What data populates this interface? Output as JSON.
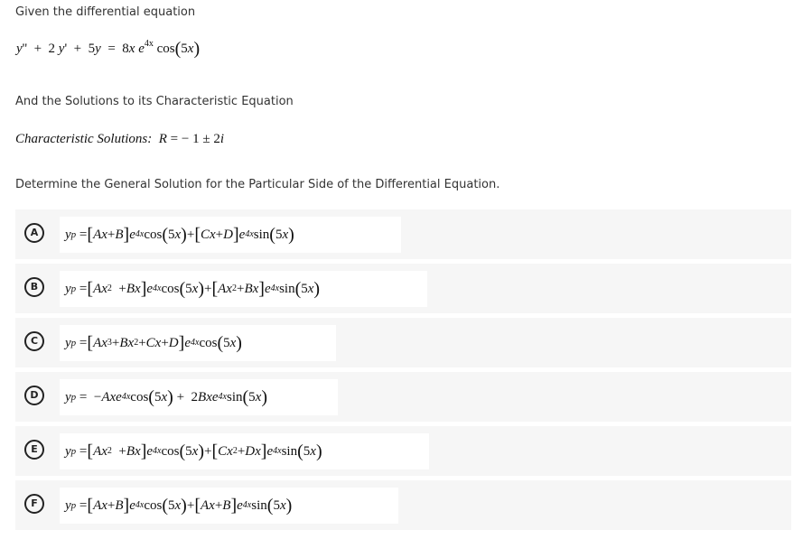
{
  "intro": "Given the differential equation",
  "given_equation": {
    "lhs": "y'' + 2 y' + 5y",
    "rhs_coef": "8x e",
    "rhs_exp": "4x",
    "rhs_trig": "cos(5x)"
  },
  "char_intro": "And the Solutions to its Characteristic Equation",
  "char_solutions": {
    "label": "Characteristic Solutions:",
    "value": "R = − 1 ± 2i"
  },
  "question": "Determine the General Solution for the Particular Side of the Differential Equation.",
  "options": [
    {
      "letter": "A",
      "formula": "y_p = [Ax + B] e^{4x} cos(5x) + [Cx + D] e^{4x} sin(5x)"
    },
    {
      "letter": "B",
      "formula": "y_p = [Ax^2 + Bx] e^{4x} cos(5x) + [Ax^2 + Bx] e^{4x} sin(5x)"
    },
    {
      "letter": "C",
      "formula": "y_p = [Ax^3 + Bx^2 + Cx + D] e^{4x} cos(5x)"
    },
    {
      "letter": "D",
      "formula": "y_p = − Ax e^{4x} cos(5x) + 2Bx e^{4x} sin(5x)"
    },
    {
      "letter": "E",
      "formula": "y_p = [Ax^2 + Bx] e^{4x} cos(5x) + [Cx^2 + Dx] e^{4x} sin(5x)"
    },
    {
      "letter": "F",
      "formula": "y_p = [Ax + B] e^{4x} cos(5x) + [Ax + B] e^{4x} sin(5x)"
    }
  ],
  "colors": {
    "option_bg": "#f6f6f6",
    "formula_bg": "#ffffff",
    "text": "#333333"
  }
}
